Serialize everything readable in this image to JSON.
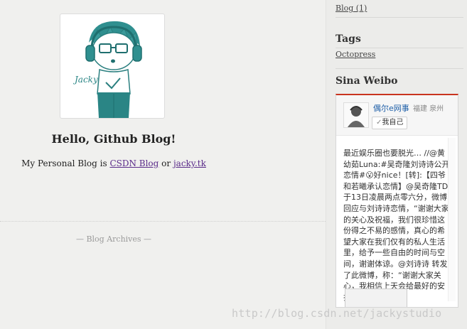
{
  "main": {
    "post_title": "Hello, Github Blog!",
    "post_intro": "My Personal Blog is ",
    "link_csdn": "CSDN Blog",
    "conjunction": " or ",
    "link_jacky": "jacky.tk",
    "archives_label": "— Blog Archives —"
  },
  "avatar": {
    "signature": "Jacky"
  },
  "sidebar": {
    "category_link": "Blog (1)",
    "tags_heading": "Tags",
    "tags": [
      "Octopress"
    ],
    "weibo_heading": "Sina Weibo"
  },
  "weibo": {
    "user_name": "偶尔e网事",
    "location": "福建 泉州",
    "follow_button": "我自己",
    "post_text": "最近娱乐圈也要脱光… //@黄幼茹Luna:#吴奇隆刘诗诗公开恋情#😮好nice！[转]:【四爷和若曦承认恋情】@吴奇隆TD 于13日凌晨两点零六分，微博回应与刘诗诗恋情，“谢谢大家的关心及祝福，我们很珍惜这份得之不易的感情，真心的希望大家在我们仅有的私人生活里，给予一些自由的时间与空间，谢谢体谅。@刘诗诗 转发了此微博，称：“谢谢大家关心，我相信上天会给最好的安排”。"
  },
  "watermark": "http://blog.csdn.net/jackystudio",
  "colors": {
    "link_visited": "#5b2c8a",
    "weibo_accent": "#c9341f",
    "weibo_name": "#1e5fa8",
    "avatar_teal": "#2f8f8f"
  }
}
